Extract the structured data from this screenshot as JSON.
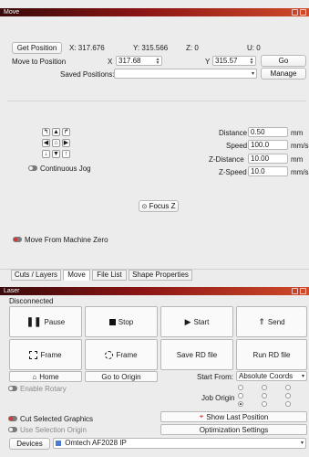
{
  "move": {
    "title": "Move",
    "get_position_label": "Get Position",
    "x_readout": "X: 317.676",
    "y_readout": "Y: 315.566",
    "z_readout": "Z: 0",
    "u_readout": "U: 0",
    "move_to_position_label": "Move to Position",
    "x_label": "X",
    "x_value": "317.68",
    "y_label": "Y",
    "y_value": "315.57",
    "go_label": "Go",
    "saved_positions_label": "Saved Positions:",
    "saved_positions_value": "",
    "manage_label": "Manage",
    "distance_label": "Distance",
    "distance_value": "0.50",
    "distance_unit": "mm",
    "speed_label": "Speed",
    "speed_value": "100.0",
    "speed_unit": "mm/s",
    "zdistance_label": "Z-Distance",
    "zdistance_value": "10.00",
    "zdistance_unit": "mm",
    "zspeed_label": "Z-Speed",
    "zspeed_value": "10.0",
    "zspeed_unit": "mm/s",
    "continuous_jog_label": "Continuous Jog",
    "focus_z_label": "Focus Z",
    "move_from_zero_label": "Move From Machine Zero",
    "jog_glyphs": [
      "↖",
      "↑",
      "↗",
      "←",
      "⌂",
      "→",
      "↙",
      "↓",
      "↘",
      "↓",
      "",
      "↑"
    ]
  },
  "tabs": [
    "Cuts / Layers",
    "Move",
    "File List",
    "Shape Properties"
  ],
  "laser": {
    "title": "Laser",
    "status": "Disconnected",
    "pause_label": "Pause",
    "stop_label": "Stop",
    "start_label": "Start",
    "send_label": "Send",
    "frame_label": "Frame",
    "frame2_label": "Frame",
    "save_rd_label": "Save RD file",
    "run_rd_label": "Run RD file",
    "home_label": "Home",
    "go_to_origin_label": "Go to Origin",
    "start_from_label": "Start From:",
    "start_from_value": "Absolute Coords",
    "enable_rotary_label": "Enable Rotary",
    "job_origin_label": "Job Origin",
    "cut_selected_label": "Cut Selected Graphics",
    "use_selection_origin_label": "Use Selection Origin",
    "show_last_position_label": "Show Last Position",
    "optimization_settings_label": "Optimization Settings",
    "devices_label": "Devices",
    "device_value": "Omtech AF2028 IP"
  },
  "colors": {
    "title_dark": "#3a0a0a",
    "title_mid": "#8a1414",
    "title_light": "#d04a2a",
    "toggle_on": "#dd3333"
  },
  "icons": [
    "jog-arrow-icons",
    "home-icon",
    "focus-z-icon",
    "pause-icon",
    "stop-icon",
    "play-icon",
    "send-icon",
    "frame-icon",
    "rotary-frame-icon",
    "home-house-icon",
    "crosshair-icon",
    "device-ip-icon"
  ]
}
